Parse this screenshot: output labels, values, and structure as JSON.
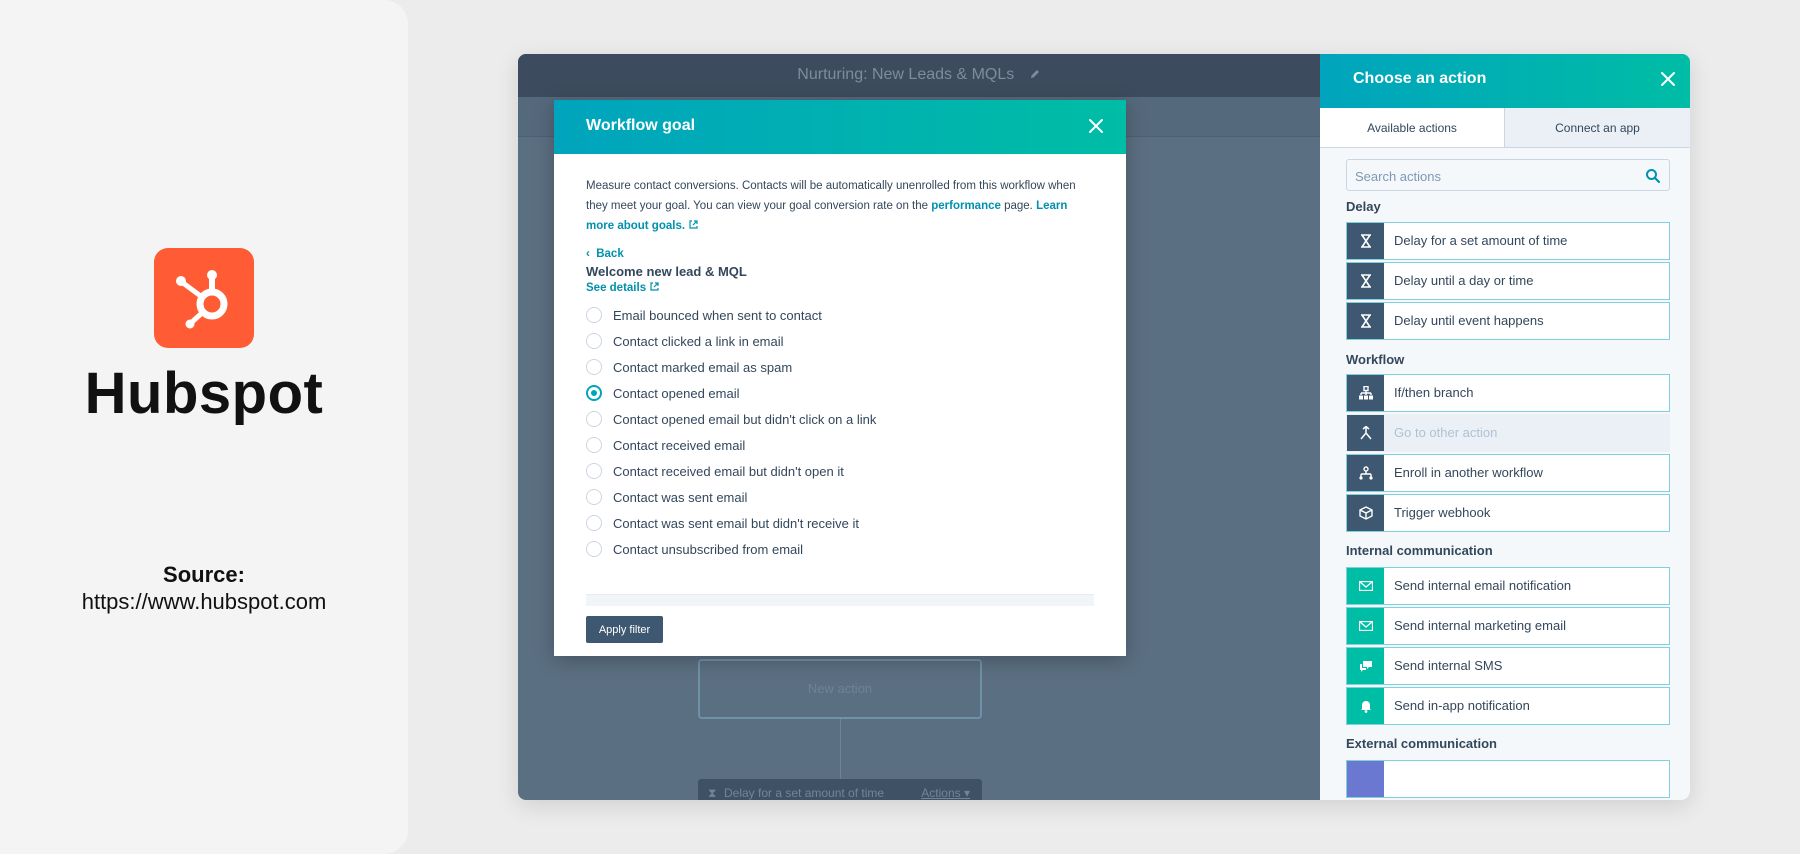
{
  "brand": {
    "name": "Hubspot",
    "source_label": "Source:",
    "source_url": "https://www.hubspot.com",
    "logo_color": "#ff5c35"
  },
  "app": {
    "workflow_title": "Nurturing: New Leads & MQLs",
    "canvas": {
      "new_action_label": "New action",
      "delay_node_label": "Delay for a set amount of time",
      "delay_node_actions": "Actions"
    }
  },
  "modal": {
    "title": "Workflow goal",
    "description_part1": "Measure contact conversions. Contacts will be automatically unenrolled from this workflow when they meet your goal. You can view your goal conversion rate on the ",
    "performance_link": "performance",
    "description_part2": " page. ",
    "learn_more_link": "Learn more about goals.",
    "back_label": "Back",
    "goal_name": "Welcome new lead & MQL",
    "see_details": "See details",
    "options": [
      {
        "label": "Email bounced when sent to contact",
        "checked": false
      },
      {
        "label": "Contact clicked a link in email",
        "checked": false
      },
      {
        "label": "Contact marked email as spam",
        "checked": false
      },
      {
        "label": "Contact opened email",
        "checked": true
      },
      {
        "label": "Contact opened email but didn't click on a link",
        "checked": false
      },
      {
        "label": "Contact received email",
        "checked": false
      },
      {
        "label": "Contact received email but didn't open it",
        "checked": false
      },
      {
        "label": "Contact was sent email",
        "checked": false
      },
      {
        "label": "Contact was sent email but didn't receive it",
        "checked": false
      },
      {
        "label": "Contact unsubscribed from email",
        "checked": false
      }
    ],
    "apply_label": "Apply filter"
  },
  "panel": {
    "title": "Choose an action",
    "tabs": [
      {
        "label": "Available actions",
        "active": true
      },
      {
        "label": "Connect an app",
        "active": false
      }
    ],
    "search_placeholder": "Search actions",
    "sections": {
      "delay": "Delay",
      "workflow": "Workflow",
      "internal": "Internal communication",
      "external": "External communication"
    },
    "delay_actions": [
      {
        "label": "Delay for a set amount of time",
        "icon": "hourglass-icon"
      },
      {
        "label": "Delay until a day or time",
        "icon": "hourglass-icon"
      },
      {
        "label": "Delay until event happens",
        "icon": "hourglass-icon"
      }
    ],
    "workflow_actions": [
      {
        "label": "If/then branch",
        "icon": "branch-icon"
      },
      {
        "label": "Go to other action",
        "icon": "merge-icon",
        "disabled": true
      },
      {
        "label": "Enroll in another workflow",
        "icon": "enroll-icon"
      },
      {
        "label": "Trigger webhook",
        "icon": "cube-icon"
      }
    ],
    "internal_actions": [
      {
        "label": "Send internal email notification",
        "icon": "envelope-icon"
      },
      {
        "label": "Send internal marketing email",
        "icon": "envelope-icon"
      },
      {
        "label": "Send internal SMS",
        "icon": "chat-icon"
      },
      {
        "label": "Send in-app notification",
        "icon": "bell-icon"
      }
    ]
  },
  "colors": {
    "teal_gradient_start": "#00a4bd",
    "teal_gradient_end": "#00bda5",
    "dark_slate": "#3e5871",
    "link": "#0091ae"
  }
}
